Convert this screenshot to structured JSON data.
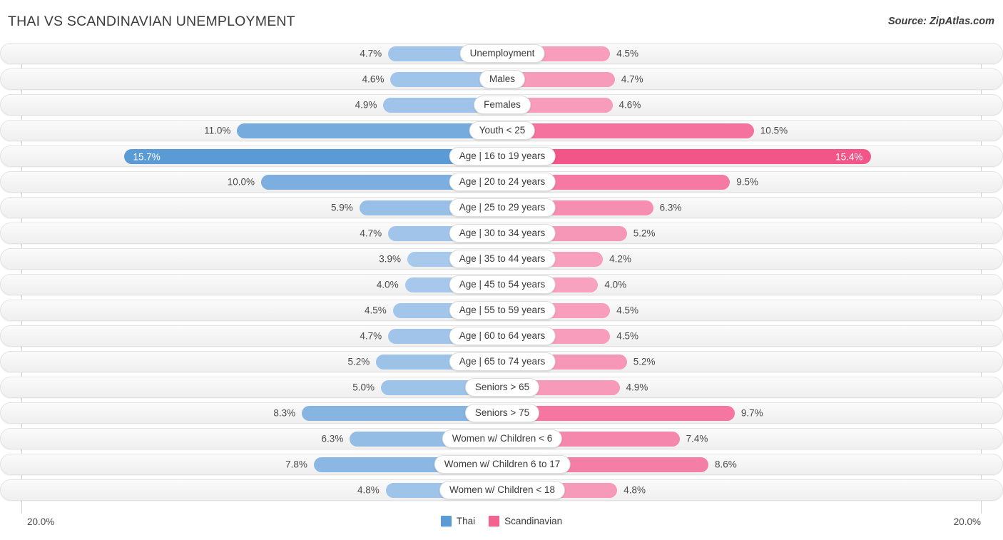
{
  "header": {
    "title": "THAI VS SCANDINAVIAN UNEMPLOYMENT",
    "source": "Source: ZipAtlas.com"
  },
  "footer": {
    "axis_min_left": "20.0%",
    "axis_min_right": "20.0%",
    "legend": [
      {
        "label": "Thai",
        "color": "#5b9bd5"
      },
      {
        "label": "Scandinavian",
        "color": "#f2638f"
      }
    ]
  },
  "chart_data": {
    "type": "bar",
    "title": "THAI VS SCANDINAVIAN UNEMPLOYMENT",
    "subtype": "diverging-horizontal",
    "xlabel": "",
    "ylabel": "",
    "axis_max": 20.0,
    "axis_min_label": "20.0%",
    "unit": "%",
    "grid": false,
    "legend_position": "bottom-center",
    "categories": [
      "Unemployment",
      "Males",
      "Females",
      "Youth < 25",
      "Age | 16 to 19 years",
      "Age | 20 to 24 years",
      "Age | 25 to 29 years",
      "Age | 30 to 34 years",
      "Age | 35 to 44 years",
      "Age | 45 to 54 years",
      "Age | 55 to 59 years",
      "Age | 60 to 64 years",
      "Age | 65 to 74 years",
      "Seniors > 65",
      "Seniors > 75",
      "Women w/ Children < 6",
      "Women w/ Children 6 to 17",
      "Women w/ Children < 18"
    ],
    "series": [
      {
        "name": "Thai",
        "color": "#5b9bd5",
        "side": "left",
        "values": [
          4.7,
          4.6,
          4.9,
          11.0,
          15.7,
          10.0,
          5.9,
          4.7,
          3.9,
          4.0,
          4.5,
          4.7,
          5.2,
          5.0,
          8.3,
          6.3,
          7.8,
          4.8
        ],
        "labels": [
          "4.7%",
          "4.6%",
          "4.9%",
          "11.0%",
          "15.7%",
          "10.0%",
          "5.9%",
          "4.7%",
          "3.9%",
          "4.0%",
          "4.5%",
          "4.7%",
          "5.2%",
          "5.0%",
          "8.3%",
          "6.3%",
          "7.8%",
          "4.8%"
        ]
      },
      {
        "name": "Scandinavian",
        "color": "#f2638f",
        "side": "right",
        "values": [
          4.5,
          4.7,
          4.6,
          10.5,
          15.4,
          9.5,
          6.3,
          5.2,
          4.2,
          4.0,
          4.5,
          4.5,
          5.2,
          4.9,
          9.7,
          7.4,
          8.6,
          4.8
        ],
        "labels": [
          "4.5%",
          "4.7%",
          "4.6%",
          "10.5%",
          "15.4%",
          "9.5%",
          "6.3%",
          "5.2%",
          "4.2%",
          "4.0%",
          "4.5%",
          "4.5%",
          "5.2%",
          "4.9%",
          "9.7%",
          "7.4%",
          "8.6%",
          "4.8%"
        ]
      }
    ]
  }
}
